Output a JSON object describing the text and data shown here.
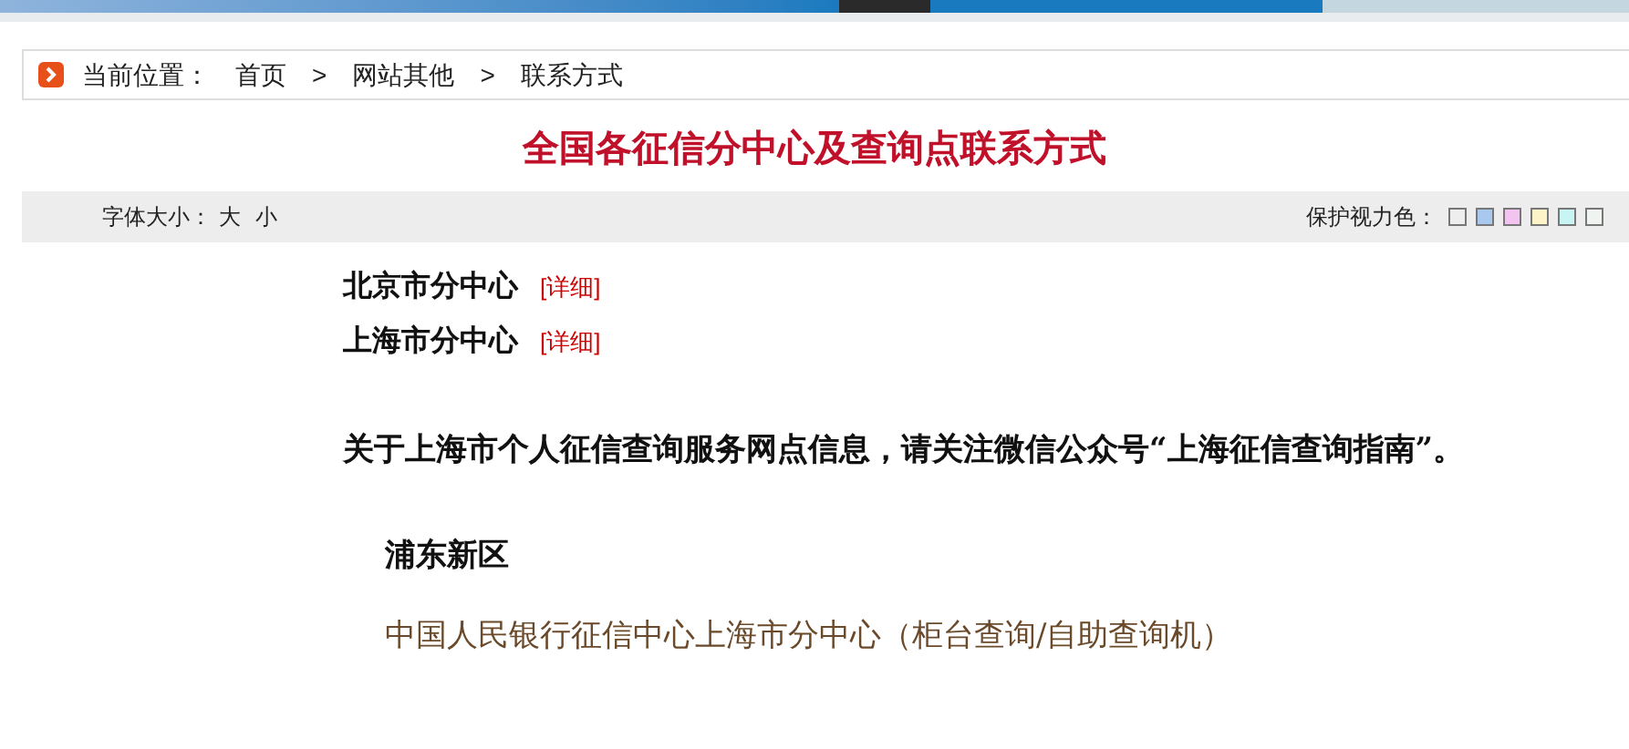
{
  "breadcrumb": {
    "label": "当前位置：",
    "items": [
      "首页",
      "网站其他",
      "联系方式"
    ],
    "separator": ">"
  },
  "title": "全国各征信分中心及查询点联系方式",
  "toolbar": {
    "font_size_label": "字体大小：",
    "font_sizes": [
      "大",
      "小"
    ],
    "eye_care_label": "保护视力色：",
    "swatches": [
      {
        "color": "#eeeeee"
      },
      {
        "color": "#a8c8f0"
      },
      {
        "color": "#f4c4f0"
      },
      {
        "color": "#fcf4c8"
      },
      {
        "color": "#c8f4f4"
      },
      {
        "color": "#f0f4f0"
      }
    ]
  },
  "centers": [
    {
      "name": "北京市分中心",
      "link": "[详细]"
    },
    {
      "name": "上海市分中心",
      "link": "[详细]"
    }
  ],
  "notice": "关于上海市个人征信查询服务网点信息，请关注微信公众号“上海征信查询指南”。",
  "district": "浦东新区",
  "office": "中国人民银行征信中心上海市分中心（柜台查询/自助查询机）"
}
